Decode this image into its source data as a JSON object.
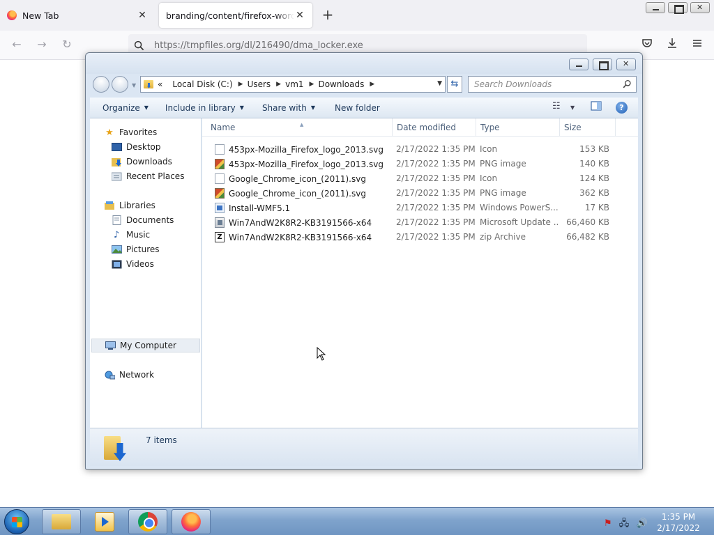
{
  "browser": {
    "tabs": [
      {
        "title": "New Tab",
        "close": "✕"
      },
      {
        "title": "branding/content/firefox-wordmark",
        "close": "✕"
      }
    ],
    "new_tab_symbol": "+",
    "url": "https://tmpfiles.org/dl/216490/dma_locker.exe",
    "icons": [
      "back-icon",
      "forward-icon",
      "reload-icon",
      "search-icon",
      "pocket-icon",
      "download-icon",
      "menu-icon"
    ]
  },
  "explorer": {
    "address": {
      "prefix": "«",
      "crumbs": [
        "Local Disk (C:)",
        "Users",
        "vm1",
        "Downloads"
      ]
    },
    "search_placeholder": "Search Downloads",
    "toolbar": {
      "organize": "Organize",
      "include_in_library": "Include in library",
      "share_with": "Share with",
      "new_folder": "New folder"
    },
    "nav": {
      "favorites": "Favorites",
      "desktop": "Desktop",
      "downloads": "Downloads",
      "recent_places": "Recent Places",
      "libraries": "Libraries",
      "documents": "Documents",
      "music": "Music",
      "pictures": "Pictures",
      "videos": "Videos",
      "my_computer": "My Computer",
      "network": "Network"
    },
    "columns": {
      "name": "Name",
      "date_modified": "Date modified",
      "type": "Type",
      "size": "Size"
    },
    "files": [
      {
        "name": "453px-Mozilla_Firefox_logo_2013.svg",
        "date": "2/17/2022 1:35 PM",
        "type": "Icon",
        "size": "153 KB",
        "icon": "blank-file-icon"
      },
      {
        "name": "453px-Mozilla_Firefox_logo_2013.svg",
        "date": "2/17/2022 1:35 PM",
        "type": "PNG image",
        "size": "140 KB",
        "icon": "png-file-icon"
      },
      {
        "name": "Google_Chrome_icon_(2011).svg",
        "date": "2/17/2022 1:35 PM",
        "type": "Icon",
        "size": "124 KB",
        "icon": "blank-file-icon"
      },
      {
        "name": "Google_Chrome_icon_(2011).svg",
        "date": "2/17/2022 1:35 PM",
        "type": "PNG image",
        "size": "362 KB",
        "icon": "png-file-icon"
      },
      {
        "name": "Install-WMF5.1",
        "date": "2/17/2022 1:35 PM",
        "type": "Windows PowerS...",
        "size": "17 KB",
        "icon": "powershell-file-icon"
      },
      {
        "name": "Win7AndW2K8R2-KB3191566-x64",
        "date": "2/17/2022 1:35 PM",
        "type": "Microsoft Update ...",
        "size": "66,460 KB",
        "icon": "msu-file-icon"
      },
      {
        "name": "Win7AndW2K8R2-KB3191566-x64",
        "date": "2/17/2022 1:35 PM",
        "type": "zip Archive",
        "size": "66,482 KB",
        "icon": "zip-file-icon"
      }
    ],
    "status": "7 items"
  },
  "taskbar": {
    "time": "1:35 PM",
    "date": "2/17/2022"
  }
}
